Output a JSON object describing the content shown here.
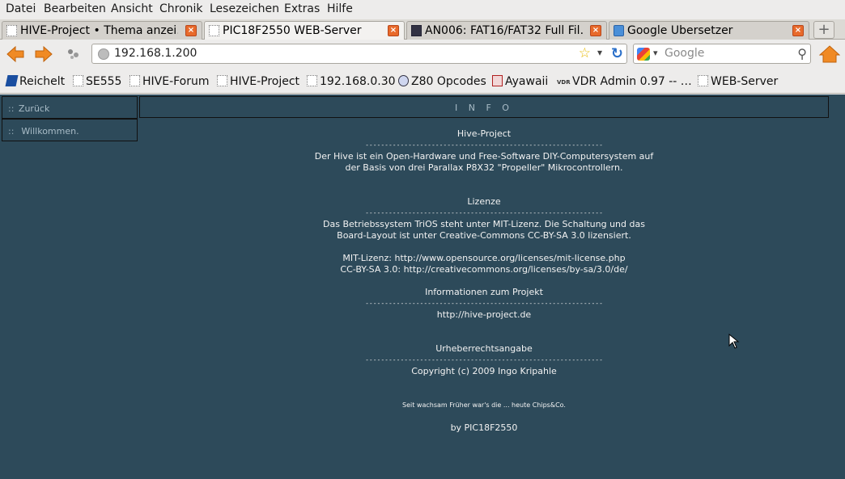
{
  "menubar": {
    "items": [
      "Datei",
      "Bearbeiten",
      "Ansicht",
      "Chronik",
      "Lesezeichen",
      "Extras",
      "Hilfe"
    ]
  },
  "tabs": [
    {
      "title": "HIVE-Project • Thema anzei…",
      "active": false
    },
    {
      "title": "PIC18F2550 WEB-Server",
      "active": true
    },
    {
      "title": "AN006: FAT16/FAT32 Full Fil…",
      "active": false
    },
    {
      "title": "Google Übersetzer",
      "active": false
    }
  ],
  "navbar": {
    "url": "192.168.1.200",
    "search_placeholder": "Google"
  },
  "bookmarks": [
    "Reichelt",
    "SE555",
    "HIVE-Forum",
    "HIVE-Project",
    "192.168.0.30",
    "Z80 Opcodes",
    "Ayawaii",
    "VDR Admin 0.97 -- …",
    "WEB-Server"
  ],
  "bookmark_icon_vdr": "VDR",
  "sidebar": {
    "prefix": "::",
    "back": "Zurück",
    "welcome": "Willkommen."
  },
  "header": {
    "title": "I N F O"
  },
  "content": {
    "dashes": "-------------------------------------------------------------",
    "sections": [
      {
        "title": "Hive-Project",
        "lines": [
          "Der Hive ist ein Open-Hardware und Free-Software DIY-Computersystem auf",
          "der Basis von drei Parallax P8X32 \"Propeller\" Mikrocontrollern."
        ]
      },
      {
        "title": "Lizenze",
        "lines": [
          "Das Betriebssystem TriOS steht unter MIT-Lizenz. Die Schaltung und das",
          "Board-Layout ist unter Creative-Commons CC-BY-SA 3.0 lizensiert."
        ],
        "extra": [
          "MIT-Lizenz: http://www.opensource.org/licenses/mit-license.php",
          "CC-BY-SA 3.0: http://creativecommons.org/licenses/by-sa/3.0/de/"
        ]
      },
      {
        "title": "Informationen zum Projekt",
        "lines": [
          "http://hive-project.de"
        ]
      },
      {
        "title": "Urheberrechtsangabe",
        "lines": [
          "Copyright (c) 2009 Ingo Kripahle"
        ]
      }
    ],
    "motto": "Seit wachsam Früher war's die ... heute Chips&Co.",
    "footer": "by PIC18F2550"
  },
  "colors": {
    "page_bg": "#2d4a5a",
    "tab_close": "#e86a2b",
    "nav_arrow": "#f08a24"
  }
}
